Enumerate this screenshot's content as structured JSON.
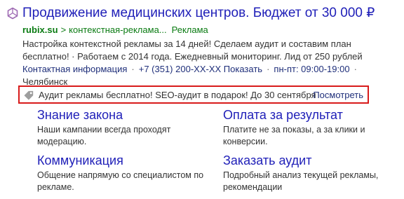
{
  "ad": {
    "title": "Продвижение медицинских центров. Бюджет от 30 000 ₽",
    "title_icon": "hexagon-logo-icon",
    "domain": "rubix.su",
    "path_separator": ">",
    "path": "контекстная-реклама...",
    "ad_label": "Реклама",
    "description": "Настройка контекстной рекламы за 14 дней! Сделаем аудит и составим план бесплатно! · Работаем с 2014 года. Ежедневный мониторинг. Лид от 250 рублей",
    "contacts": {
      "info_link": "Контактная информация",
      "separator": "·",
      "phone": "+7 (351) 200-XX-XX",
      "show_link": "Показать",
      "hours": "пн-пт: 09:00-19:00",
      "city": "Челябинск"
    },
    "promo": {
      "icon": "tag-icon",
      "text": "Аудит рекламы бесплатно! SEO-аудит в подарок! До 30 сентября",
      "link": "Посмотреть"
    },
    "sitelinks": [
      {
        "title": "Знание закона",
        "description": "Наши кампании всегда проходят модерацию."
      },
      {
        "title": "Оплата за результат",
        "description": "Платите не за показы, а за клики и конверсии."
      },
      {
        "title": "Коммуникация",
        "description": "Общение напрямую со специалистом по рекламе."
      },
      {
        "title": "Заказать аудит",
        "description": "Подробный анализ текущей рекламы, рекомендации"
      }
    ]
  },
  "colors": {
    "title_link": "#1f1fb8",
    "url_green": "#0a7b12",
    "text": "#333333",
    "contact_link": "#1f2f7a",
    "promo_border": "#d81b1b",
    "logo_icon": "#9f6bb4",
    "tag_icon": "#9e9e9e"
  }
}
